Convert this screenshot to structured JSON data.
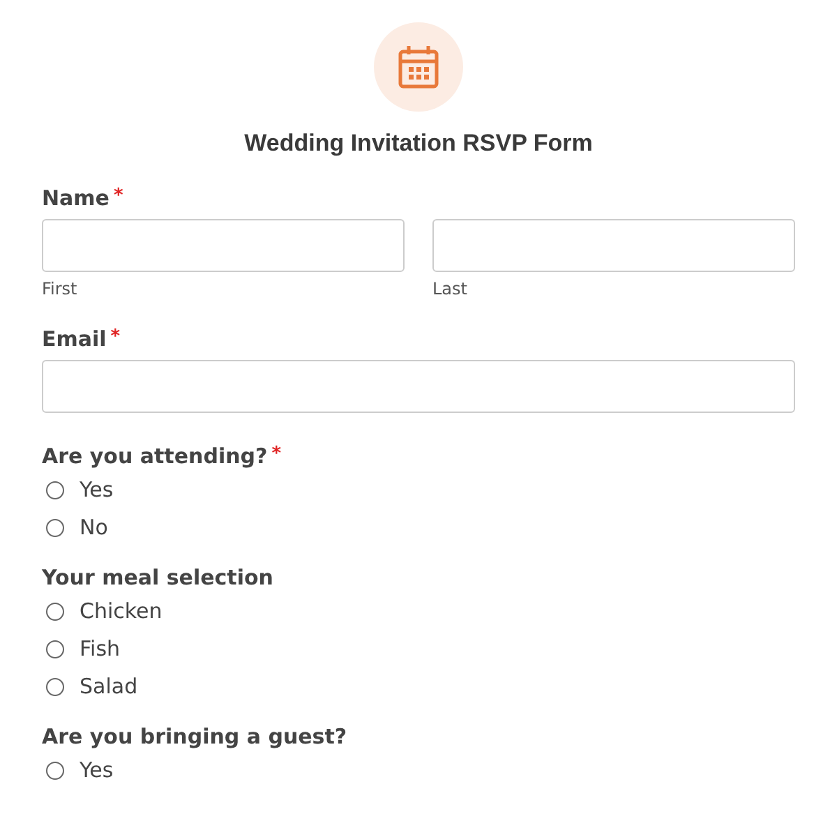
{
  "form": {
    "title": "Wedding Invitation RSVP Form"
  },
  "name_field": {
    "label": "Name",
    "required_mark": "*",
    "parts": [
      {
        "sublabel": "First"
      },
      {
        "sublabel": "Last"
      }
    ]
  },
  "email_field": {
    "label": "Email",
    "required_mark": "*"
  },
  "questions": [
    {
      "label": "Are you attending?",
      "required_mark": "*",
      "options": [
        {
          "label": "Yes",
          "selected": false
        },
        {
          "label": "No",
          "selected": false
        }
      ]
    },
    {
      "label": "Your meal selection",
      "options": [
        {
          "label": "Chicken",
          "selected": false
        },
        {
          "label": "Fish",
          "selected": false
        },
        {
          "label": "Salad",
          "selected": false
        }
      ]
    },
    {
      "label": "Are you bringing a guest?",
      "options": [
        {
          "label": "Yes",
          "selected": false
        }
      ]
    }
  ]
}
